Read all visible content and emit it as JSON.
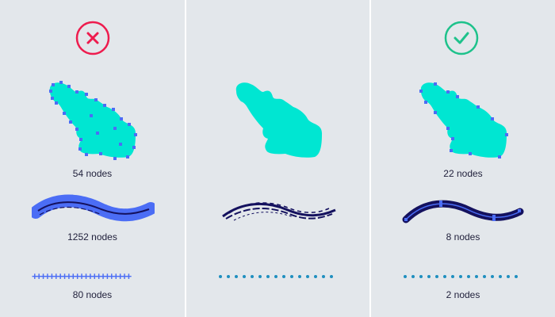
{
  "colors": {
    "background": "#e3e7eb",
    "divider": "#ffffff",
    "shape_fill": "#00e6d2",
    "node": "#4b6df5",
    "stroke_dark": "#14115e",
    "bad": "#ee1c4e",
    "good": "#1ec28b",
    "dot": "#1f8fbf"
  },
  "left": {
    "badge_icon": "close-icon",
    "leaf_label": "54 nodes",
    "brush_label": "1252 nodes",
    "dots_label": "80 nodes"
  },
  "middle": {},
  "right": {
    "badge_icon": "check-icon",
    "leaf_label": "22 nodes",
    "brush_label": "8 nodes",
    "dots_label": "2 nodes"
  }
}
